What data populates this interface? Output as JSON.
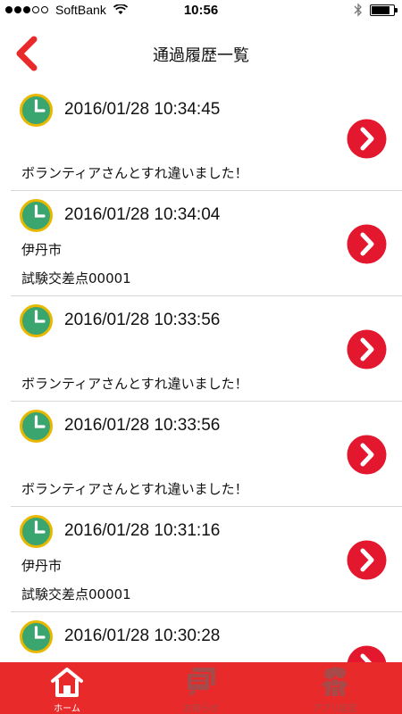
{
  "status_bar": {
    "carrier": "SoftBank",
    "time": "10:56",
    "signal_bars": 3,
    "battery_level": 0.75
  },
  "nav": {
    "title": "通過履歴一覧",
    "back_icon": "chevron-left-icon"
  },
  "history": {
    "items": [
      {
        "timestamp": "2016/01/28 10:34:45",
        "line1": "",
        "line2": "ボランティアさんとすれ違いました！"
      },
      {
        "timestamp": "2016/01/28 10:34:04",
        "line1": "伊丹市",
        "line2": "試験交差点00001"
      },
      {
        "timestamp": "2016/01/28 10:33:56",
        "line1": "",
        "line2": "ボランティアさんとすれ違いました！"
      },
      {
        "timestamp": "2016/01/28 10:33:56",
        "line1": "",
        "line2": "ボランティアさんとすれ違いました！"
      },
      {
        "timestamp": "2016/01/28 10:31:16",
        "line1": "伊丹市",
        "line2": "試験交差点00001"
      },
      {
        "timestamp": "2016/01/28 10:30:28",
        "line1": "",
        "line2": ""
      }
    ]
  },
  "tabs": [
    {
      "label": "ホーム",
      "icon": "home-icon",
      "active": true
    },
    {
      "label": "お知らせ",
      "icon": "chat-icon",
      "active": false
    },
    {
      "label": "アプリ設定",
      "icon": "people-icon",
      "active": false
    }
  ],
  "colors": {
    "accent_red": "#e82a2a",
    "clock_green": "#3aa56e",
    "clock_ring": "#e8b800"
  }
}
